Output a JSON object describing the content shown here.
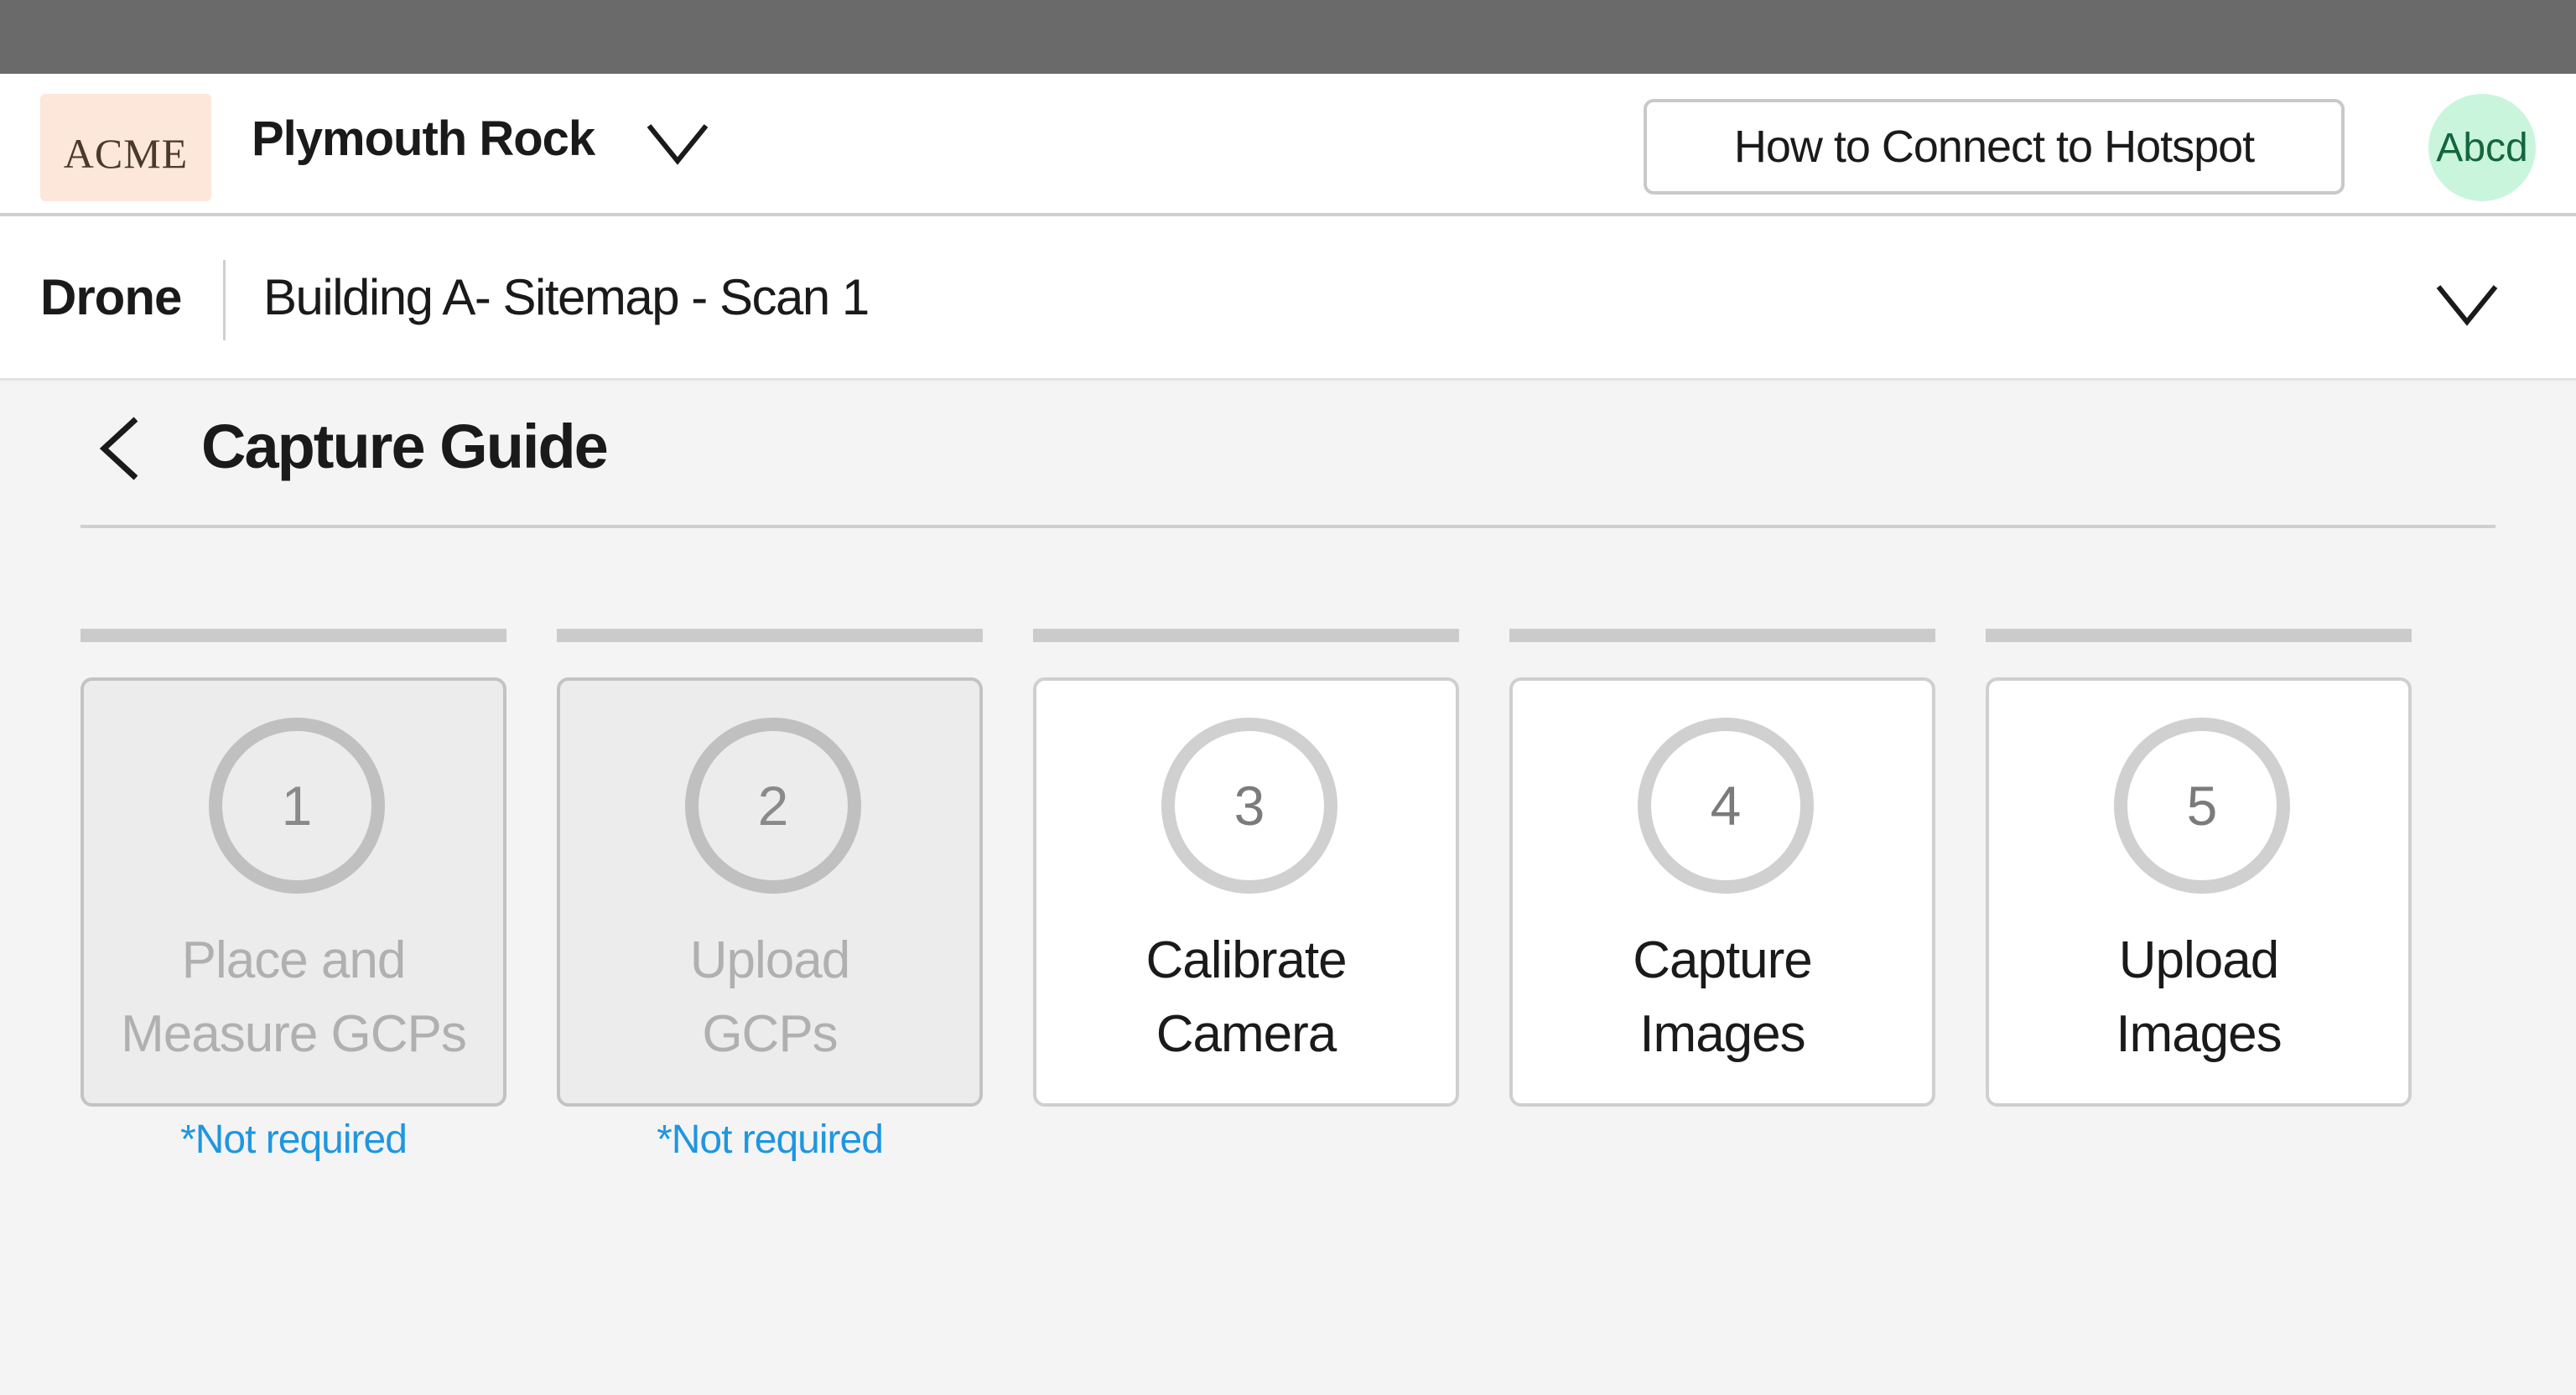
{
  "header": {
    "logo_text": "ACME",
    "project_name": "Plymouth Rock",
    "hotspot_button": "How to Connect to Hotspot",
    "avatar_text": "Abcd"
  },
  "subheader": {
    "type": "Drone",
    "scan_name": "Building A- Sitemap - Scan 1"
  },
  "page": {
    "title": "Capture Guide"
  },
  "steps": [
    {
      "number": "1",
      "line1": "Place and",
      "line2": "Measure GCPs",
      "note": "*Not required",
      "state": "disabled"
    },
    {
      "number": "2",
      "line1": "Upload",
      "line2": "GCPs",
      "note": "*Not required",
      "state": "disabled"
    },
    {
      "number": "3",
      "line1": "Calibrate",
      "line2": "Camera",
      "note": "",
      "state": "enabled"
    },
    {
      "number": "4",
      "line1": "Capture",
      "line2": "Images",
      "note": "",
      "state": "enabled"
    },
    {
      "number": "5",
      "line1": "Upload",
      "line2": "Images",
      "note": "",
      "state": "enabled"
    }
  ],
  "colors": {
    "status_bar": "#6a6a6a",
    "logo_bg": "#fde6da",
    "avatar_bg": "#c9f5dc",
    "note_text": "#1f96e0",
    "background": "#f4f4f4"
  },
  "icons": {
    "project_dropdown": "chevron-down-icon",
    "scan_dropdown": "chevron-down-icon",
    "back": "chevron-left-icon"
  }
}
